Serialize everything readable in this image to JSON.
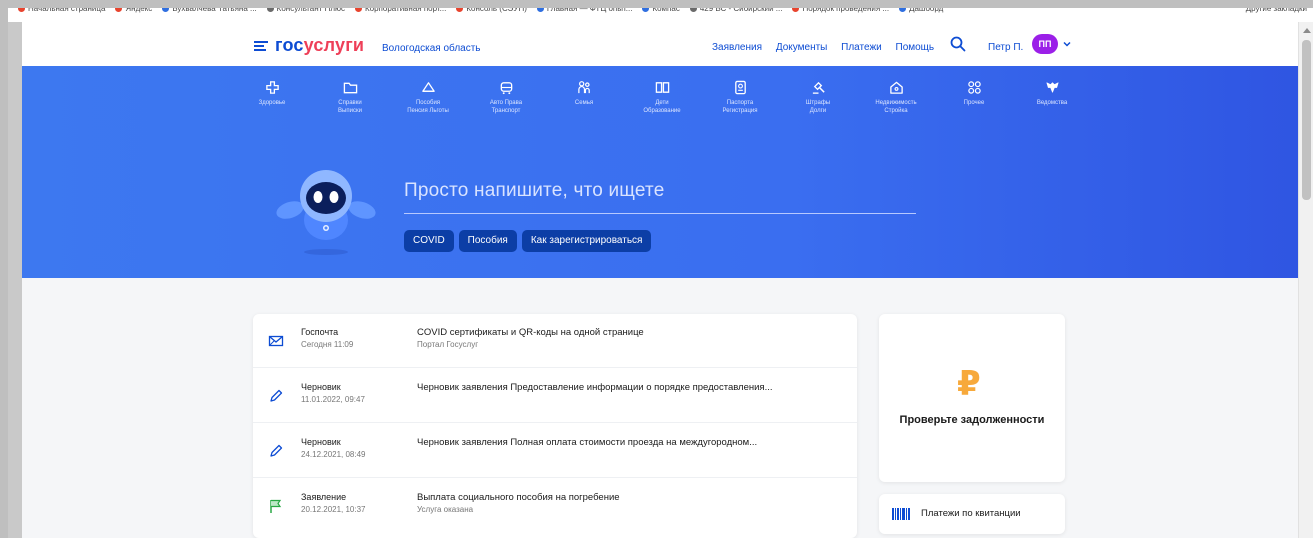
{
  "bookmarks": {
    "items": [
      {
        "label": "Начальная страница",
        "color": "#e8442e"
      },
      {
        "label": "Яндекс",
        "color": "#e8442e"
      },
      {
        "label": "Бухвалчева Татьяна ...",
        "color": "#2f6fe0"
      },
      {
        "label": "Консультант Плюс",
        "color": "#6a6a6a"
      },
      {
        "label": "Корпоративная порт...",
        "color": "#e8442e"
      },
      {
        "label": "Консоль (СЭУП)",
        "color": "#e8442e"
      },
      {
        "label": "Главная — ФТЦ опыт...",
        "color": "#2f6fe0"
      },
      {
        "label": "Компас",
        "color": "#2f6fe0"
      },
      {
        "label": "429 ВС - Сибирский ...",
        "color": "#6a6a6a"
      },
      {
        "label": "Порядок проведения ...",
        "color": "#e8442e"
      },
      {
        "label": "Дашборд",
        "color": "#2f6fe0"
      }
    ],
    "other": "Другие закладки"
  },
  "header": {
    "logo_part1": "гос",
    "logo_part2": "услуги",
    "region": "Вологодская область",
    "nav": [
      "Заявления",
      "Документы",
      "Платежи",
      "Помощь"
    ],
    "user_name": "Петр П.",
    "avatar_initials": "ПП",
    "brand_color": "#0d4cd3",
    "avatar_color": "#9b1fe8"
  },
  "categories": [
    {
      "icon": "cross-icon",
      "line1": "Здоровье",
      "line2": ""
    },
    {
      "icon": "folder-icon",
      "line1": "Справки",
      "line2": "Выписки"
    },
    {
      "icon": "umbrella-icon",
      "line1": "Пособия",
      "line2": "Пенсия Льготы"
    },
    {
      "icon": "car-icon",
      "line1": "Авто Права",
      "line2": "Транспорт"
    },
    {
      "icon": "family-icon",
      "line1": "Семья",
      "line2": ""
    },
    {
      "icon": "book-icon",
      "line1": "Дети",
      "line2": "Образование"
    },
    {
      "icon": "passport-icon",
      "line1": "Паспорта",
      "line2": "Регистрация"
    },
    {
      "icon": "gavel-icon",
      "line1": "Штрафы",
      "line2": "Долги"
    },
    {
      "icon": "house-icon",
      "line1": "Недвижимость",
      "line2": "Стройка"
    },
    {
      "icon": "grid-icon",
      "line1": "Прочее",
      "line2": ""
    },
    {
      "icon": "eagle-icon",
      "line1": "Ведомства",
      "line2": ""
    }
  ],
  "hero": {
    "search_placeholder": "Просто напишите, что ищете",
    "chips": [
      "COVID",
      "Пособия",
      "Как зарегистрироваться"
    ]
  },
  "feed": [
    {
      "icon": "mail-icon",
      "type": "Госпочта",
      "date": "Сегодня 11:09",
      "title": "COVID сертификаты и QR-коды на одной странице",
      "subtitle": "Портал Госуслуг"
    },
    {
      "icon": "pencil-icon",
      "type": "Черновик",
      "date": "11.01.2022, 09:47",
      "title": "Черновик заявления Предоставление информации о порядке предоставления...",
      "subtitle": ""
    },
    {
      "icon": "pencil-icon",
      "type": "Черновик",
      "date": "24.12.2021, 08:49",
      "title": "Черновик заявления Полная оплата стоимости проезда на междугородном...",
      "subtitle": ""
    },
    {
      "icon": "flag-icon",
      "type": "Заявление",
      "date": "20.12.2021, 10:37",
      "title": "Выплата социального пособия на погребение",
      "subtitle": "Услуга оказана"
    }
  ],
  "side": {
    "debt_label": "Проверьте задолженности",
    "ruble_symbol": "₽",
    "pay_label": "Платежи по квитанции",
    "ruble_color": "#f7a93b"
  }
}
